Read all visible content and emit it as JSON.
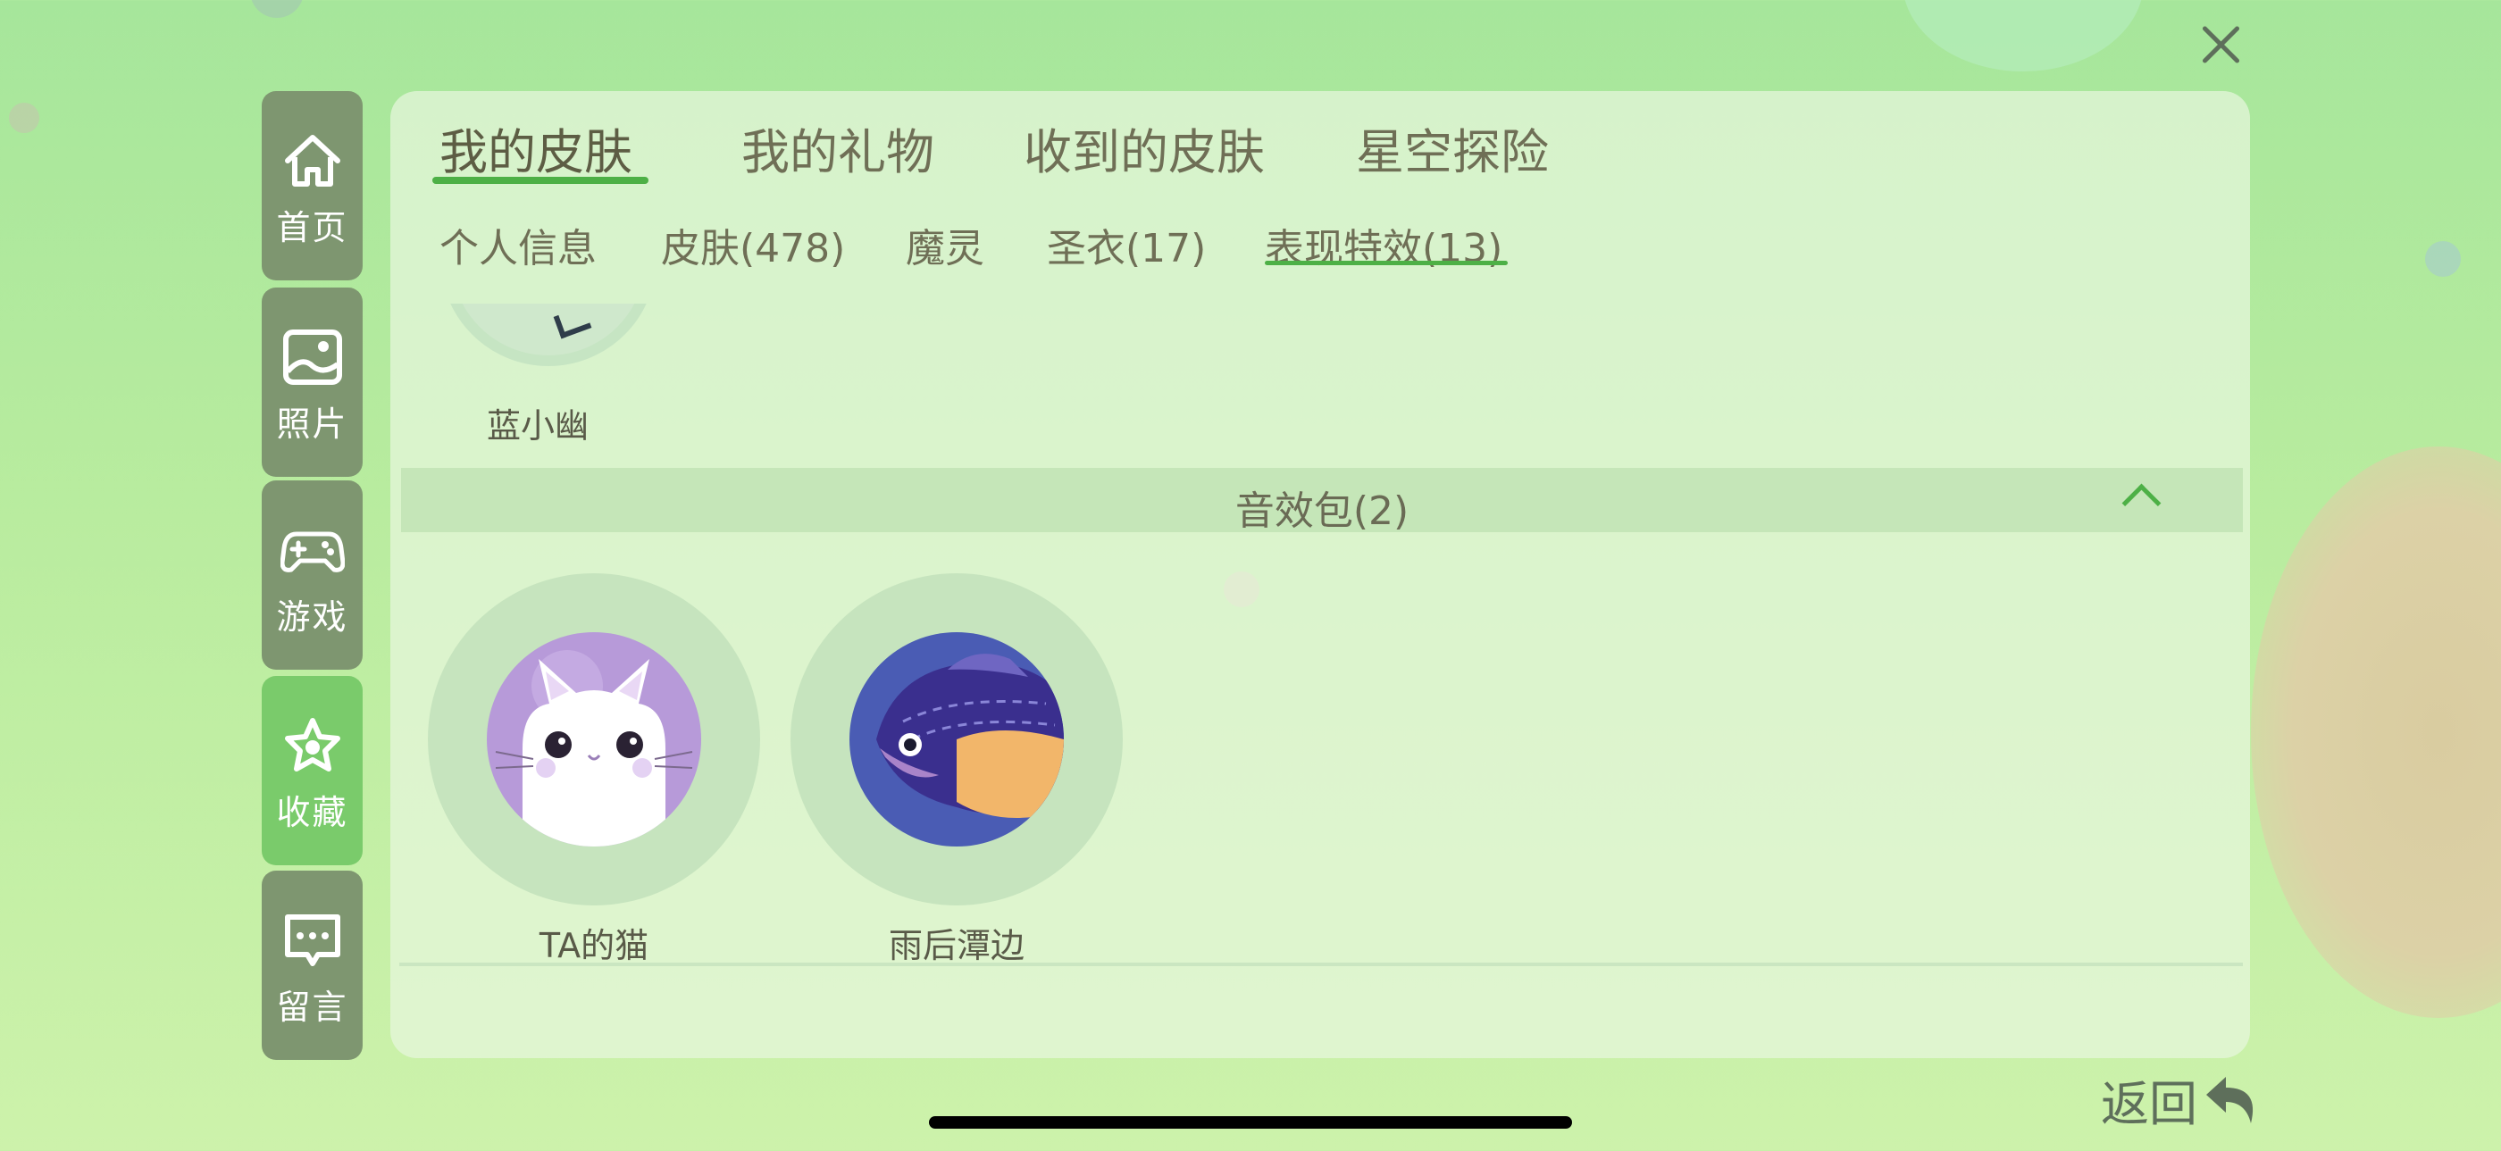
{
  "close": {
    "icon": "close-icon"
  },
  "sidebar": {
    "items": [
      {
        "label": "首页",
        "icon": "home-icon",
        "active": false
      },
      {
        "label": "照片",
        "icon": "photo-icon",
        "active": false
      },
      {
        "label": "游戏",
        "icon": "gamepad-icon",
        "active": false
      },
      {
        "label": "收藏",
        "icon": "star-icon",
        "active": true
      },
      {
        "label": "留言",
        "icon": "message-icon",
        "active": false
      }
    ]
  },
  "tabs": [
    {
      "label": "我的皮肤",
      "active": true
    },
    {
      "label": "我的礼物",
      "active": false
    },
    {
      "label": "收到的皮肤",
      "active": false
    },
    {
      "label": "星空探险",
      "active": false
    }
  ],
  "subtabs": [
    {
      "label": "个人信息",
      "active": false
    },
    {
      "label": "皮肤(478)",
      "active": false
    },
    {
      "label": "魔灵",
      "active": false
    },
    {
      "label": "圣衣(17)",
      "active": false
    },
    {
      "label": "表现特效(13)",
      "active": true
    }
  ],
  "partial_item": {
    "label": "蓝小幽"
  },
  "section": {
    "title": "音效包(2)",
    "icon": "chevron-up-icon"
  },
  "sound_packs": [
    {
      "label": "TA的猫",
      "icon": "cat-image"
    },
    {
      "label": "雨后潭边",
      "icon": "fish-image"
    }
  ],
  "back": {
    "label": "返回",
    "icon": "back-arrow-icon"
  },
  "colors": {
    "accent": "#4db046",
    "sidebar_item": "#7e9670",
    "sidebar_active": "#7acb6b",
    "text": "#6f6f56"
  }
}
